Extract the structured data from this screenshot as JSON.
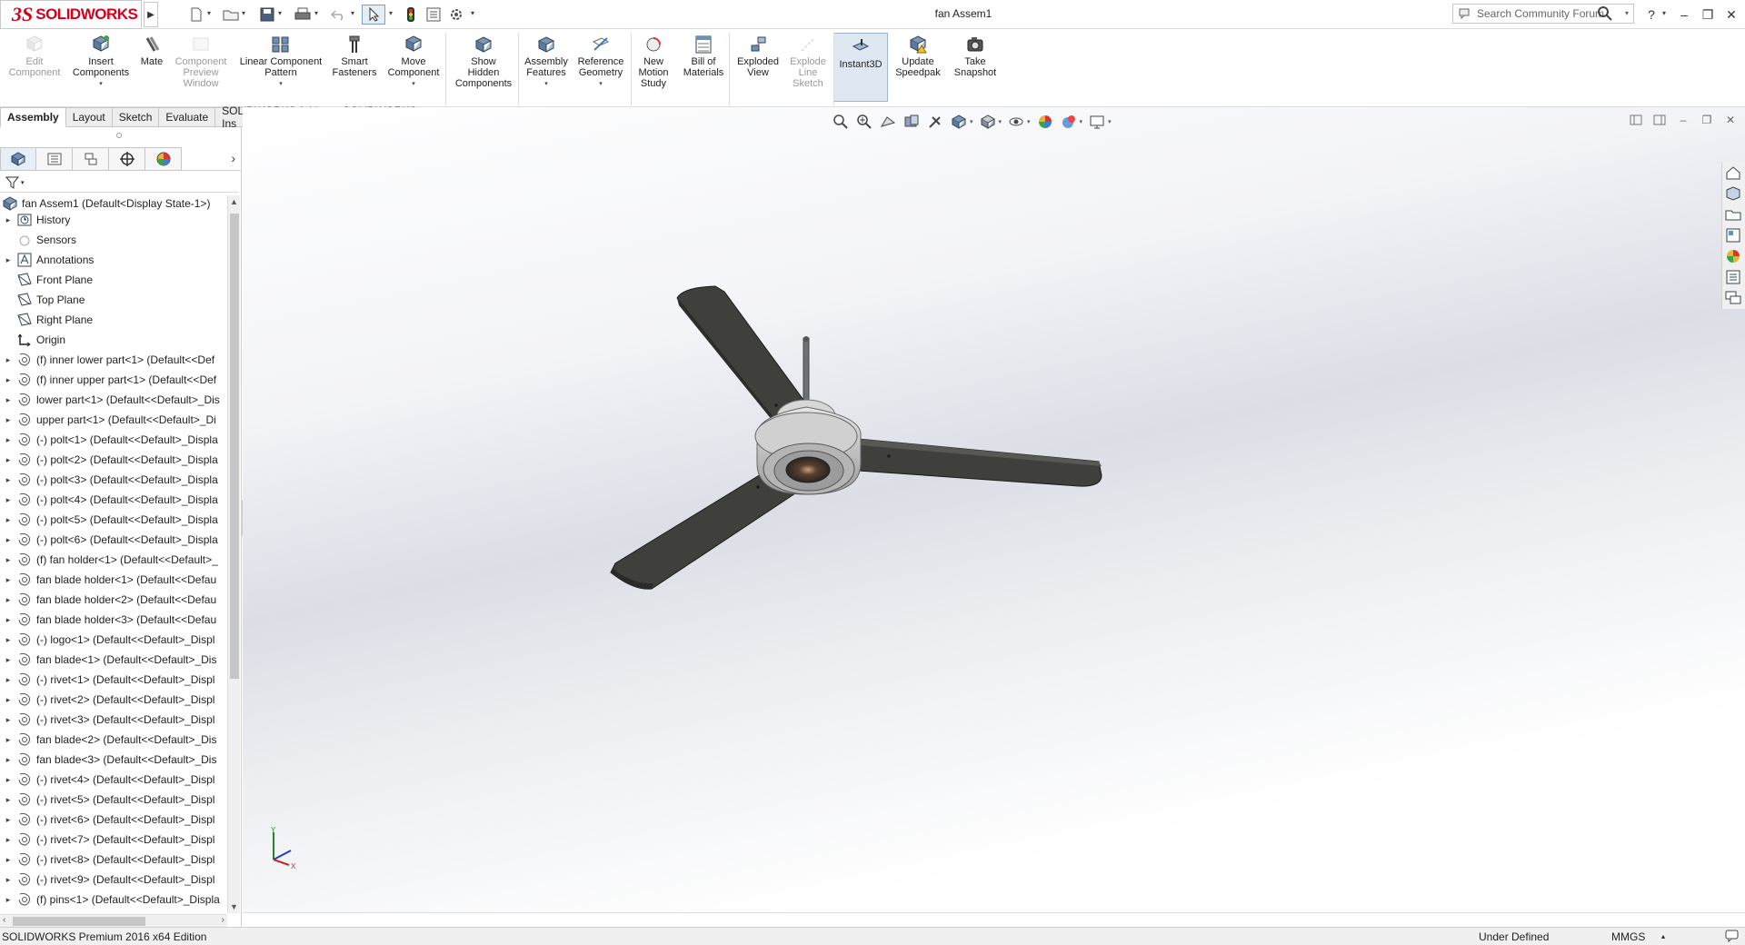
{
  "app": {
    "brand_mark": "3S",
    "brand_word": "SOLIDWORKS",
    "document_title": "fan Assem1",
    "search_placeholder": "Search Community Forum"
  },
  "quick_access": [
    {
      "name": "new-icon"
    },
    {
      "name": "open-icon"
    },
    {
      "name": "save-icon"
    },
    {
      "name": "print-icon"
    },
    {
      "name": "undo-icon"
    },
    {
      "name": "select-icon"
    },
    {
      "name": "rebuild-icon"
    },
    {
      "name": "file-properties-icon"
    },
    {
      "name": "options-icon"
    }
  ],
  "commands": [
    {
      "label_lines": [
        "Edit",
        "Component"
      ],
      "icon": "edit-component-icon",
      "disabled": true
    },
    {
      "label_lines": [
        "Insert",
        "Components"
      ],
      "icon": "insert-components-icon",
      "dropdown": true
    },
    {
      "label_lines": [
        "Mate"
      ],
      "icon": "mate-icon"
    },
    {
      "label_lines": [
        "Component",
        "Preview",
        "Window"
      ],
      "icon": "component-preview-icon",
      "disabled": true
    },
    {
      "label_lines": [
        "Linear Component",
        "Pattern"
      ],
      "icon": "linear-pattern-icon",
      "dropdown": true
    },
    {
      "label_lines": [
        "Smart",
        "Fasteners"
      ],
      "icon": "smart-fasteners-icon"
    },
    {
      "label_lines": [
        "Move",
        "Component"
      ],
      "icon": "move-component-icon",
      "dropdown": true
    },
    {
      "label_lines": [
        "Show",
        "Hidden",
        "Components"
      ],
      "icon": "show-hidden-icon"
    },
    {
      "label_lines": [
        "Assembly",
        "Features"
      ],
      "icon": "assembly-features-icon",
      "dropdown": true
    },
    {
      "label_lines": [
        "Reference",
        "Geometry"
      ],
      "icon": "reference-geometry-icon",
      "dropdown": true
    },
    {
      "label_lines": [
        "New",
        "Motion",
        "Study"
      ],
      "icon": "motion-study-icon"
    },
    {
      "label_lines": [
        "Bill of",
        "Materials"
      ],
      "icon": "bom-icon"
    },
    {
      "label_lines": [
        "Exploded",
        "View"
      ],
      "icon": "exploded-view-icon"
    },
    {
      "label_lines": [
        "Explode",
        "Line",
        "Sketch"
      ],
      "icon": "explode-line-icon",
      "disabled": true
    },
    {
      "label_lines": [
        "Instant3D"
      ],
      "icon": "instant3d-icon",
      "active": true
    },
    {
      "label_lines": [
        "Update",
        "Speedpak"
      ],
      "icon": "speedpak-icon"
    },
    {
      "label_lines": [
        "Take",
        "Snapshot"
      ],
      "icon": "snapshot-icon"
    }
  ],
  "tabs": [
    "Assembly",
    "Layout",
    "Sketch",
    "Evaluate",
    "SOLIDWORKS Add-Ins",
    "SOLIDWORKS MBD"
  ],
  "active_tab": "Assembly",
  "tree": {
    "root": "fan Assem1  (Default<Display State-1>)",
    "items": [
      {
        "label": "History",
        "type": "history",
        "expand": true
      },
      {
        "label": "Sensors",
        "type": "sensors",
        "expand": false
      },
      {
        "label": "Annotations",
        "type": "annotations",
        "expand": true
      },
      {
        "label": "Front Plane",
        "type": "plane",
        "expand": false
      },
      {
        "label": "Top Plane",
        "type": "plane",
        "expand": false
      },
      {
        "label": "Right Plane",
        "type": "plane",
        "expand": false
      },
      {
        "label": "Origin",
        "type": "origin",
        "expand": false
      },
      {
        "label": "(f) inner lower part<1> (Default<<Def",
        "type": "part",
        "expand": true
      },
      {
        "label": "(f) inner upper part<1> (Default<<Def",
        "type": "part",
        "expand": true
      },
      {
        "label": "lower part<1> (Default<<Default>_Dis",
        "type": "part",
        "expand": true
      },
      {
        "label": "upper part<1> (Default<<Default>_Di",
        "type": "part",
        "expand": true
      },
      {
        "label": "(-) polt<1> (Default<<Default>_Displa",
        "type": "part",
        "expand": true
      },
      {
        "label": "(-) polt<2> (Default<<Default>_Displa",
        "type": "part",
        "expand": true
      },
      {
        "label": "(-) polt<3> (Default<<Default>_Displa",
        "type": "part",
        "expand": true
      },
      {
        "label": "(-) polt<4> (Default<<Default>_Displa",
        "type": "part",
        "expand": true
      },
      {
        "label": "(-) polt<5> (Default<<Default>_Displa",
        "type": "part",
        "expand": true
      },
      {
        "label": "(-) polt<6> (Default<<Default>_Displa",
        "type": "part",
        "expand": true
      },
      {
        "label": "(f) fan holder<1> (Default<<Default>_",
        "type": "part",
        "expand": true
      },
      {
        "label": "fan blade holder<1> (Default<<Defau",
        "type": "part",
        "expand": true
      },
      {
        "label": "fan blade holder<2> (Default<<Defau",
        "type": "part",
        "expand": true
      },
      {
        "label": "fan blade holder<3> (Default<<Defau",
        "type": "part",
        "expand": true
      },
      {
        "label": "(-) logo<1> (Default<<Default>_Displ",
        "type": "part",
        "expand": true
      },
      {
        "label": "fan blade<1> (Default<<Default>_Dis",
        "type": "part",
        "expand": true
      },
      {
        "label": "(-) rivet<1> (Default<<Default>_Displ",
        "type": "part",
        "expand": true
      },
      {
        "label": "(-) rivet<2> (Default<<Default>_Displ",
        "type": "part",
        "expand": true
      },
      {
        "label": "(-) rivet<3> (Default<<Default>_Displ",
        "type": "part",
        "expand": true
      },
      {
        "label": "fan blade<2> (Default<<Default>_Dis",
        "type": "part",
        "expand": true
      },
      {
        "label": "fan blade<3> (Default<<Default>_Dis",
        "type": "part",
        "expand": true
      },
      {
        "label": "(-) rivet<4> (Default<<Default>_Displ",
        "type": "part",
        "expand": true
      },
      {
        "label": "(-) rivet<5> (Default<<Default>_Displ",
        "type": "part",
        "expand": true
      },
      {
        "label": "(-) rivet<6> (Default<<Default>_Displ",
        "type": "part",
        "expand": true
      },
      {
        "label": "(-) rivet<7> (Default<<Default>_Displ",
        "type": "part",
        "expand": true
      },
      {
        "label": "(-) rivet<8> (Default<<Default>_Displ",
        "type": "part",
        "expand": true
      },
      {
        "label": "(-) rivet<9> (Default<<Default>_Displ",
        "type": "part",
        "expand": true
      },
      {
        "label": "(f) pins<1> (Default<<Default>_Displa",
        "type": "part",
        "expand": true
      }
    ]
  },
  "triad_labels": {
    "y": "Y",
    "x": "X"
  },
  "status": {
    "edition": "SOLIDWORKS Premium 2016 x64 Edition",
    "definition": "Under Defined",
    "units": "MMGS"
  },
  "colors": {
    "brand": "#d6001c",
    "blade": "#3f3f3c",
    "hub": "#bdbdbd",
    "viewport_mid": "#dcdee6"
  }
}
